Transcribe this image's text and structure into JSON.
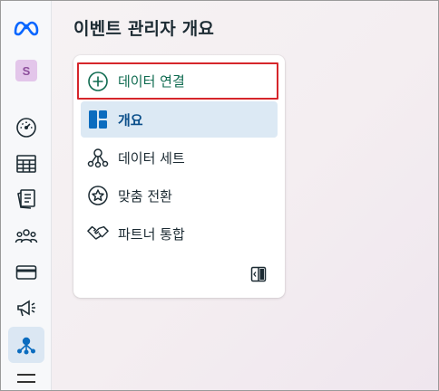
{
  "app": {
    "logo_icon": "meta-logo-icon",
    "avatar_letter": "S"
  },
  "rail": {
    "items": [
      {
        "name": "dashboard",
        "icon": "gauge-icon",
        "active": false
      },
      {
        "name": "table",
        "icon": "table-icon",
        "active": false
      },
      {
        "name": "pages",
        "icon": "pages-icon",
        "active": false
      },
      {
        "name": "audiences",
        "icon": "people-icon",
        "active": false
      },
      {
        "name": "billing",
        "icon": "credit-card-icon",
        "active": false
      },
      {
        "name": "ads",
        "icon": "megaphone-icon",
        "active": false
      },
      {
        "name": "events-manager",
        "icon": "network-icon",
        "active": true
      }
    ],
    "menu_icon": "hamburger-icon"
  },
  "header": {
    "title": "이벤트 관리자 개요"
  },
  "nav": {
    "connect_data": "데이터 연결",
    "overview": "개요",
    "datasets": "데이터 세트",
    "custom_conversions": "맞춤 전환",
    "partner_integrations": "파트너 통합"
  },
  "colors": {
    "meta_blue": "#0866ff",
    "active_bg": "#dce9f4",
    "active_text": "#0b4f8a",
    "connect_green": "#0f6b50",
    "highlight_red": "#d6262b"
  }
}
